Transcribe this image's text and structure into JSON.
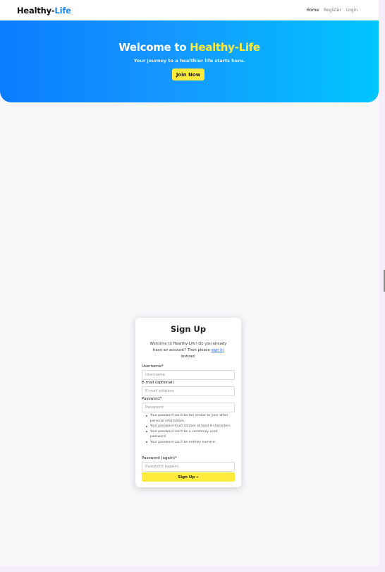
{
  "navbar": {
    "brand_main": "Healthy-",
    "brand_accent": "Life",
    "links": [
      "Home",
      "Register",
      "Login"
    ]
  },
  "hero": {
    "title_main": "Welcome to ",
    "title_accent": "Healthy-Life",
    "subtitle": "Your journey to a healthier life starts here.",
    "cta_label": "Join Now"
  },
  "signup": {
    "title": "Sign Up",
    "intro_before": "Welcome to Healthy-Life! Do you already have an account? Then please ",
    "intro_link": "sign in",
    "intro_after": " instead.",
    "username_label": "Username*",
    "username_placeholder": "Username",
    "email_label": "E-mail (optional)",
    "email_placeholder": "E-mail address",
    "password_label": "Password*",
    "password_placeholder": "Password",
    "password_help": [
      "Your password can’t be too similar to your other personal information.",
      "Your password must contain at least 8 characters.",
      "Your password can’t be a commonly used password.",
      "Your password can’t be entirely numeric."
    ],
    "password2_label": "Password (again)*",
    "password2_placeholder": "Password (again)",
    "submit_label": "Sign Up »"
  },
  "colors": {
    "accent_blue": "#1e88e5",
    "accent_yellow": "#ffeb3b",
    "hero_gradient_start": "#0a7cff",
    "hero_gradient_end": "#00c6ff"
  }
}
